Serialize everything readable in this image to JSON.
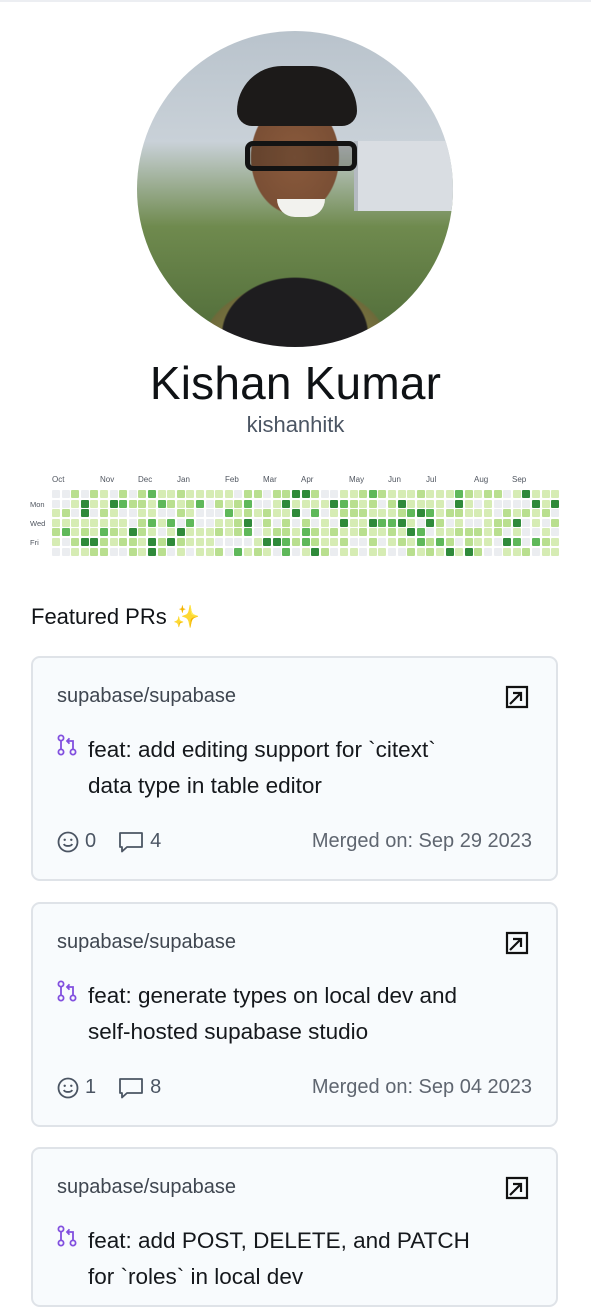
{
  "profile": {
    "name": "Kishan Kumar",
    "handle": "kishanhitk"
  },
  "contributions": {
    "months": [
      "Oct",
      "Nov",
      "Dec",
      "Jan",
      "Feb",
      "Mar",
      "Apr",
      "May",
      "Jun",
      "Jul",
      "Aug",
      "Sep"
    ],
    "days": [
      "Mon",
      "Wed",
      "Fri"
    ],
    "colors": {
      "none": "#ebedf0",
      "l1": "#d6ecb4",
      "l2": "#b9df8f",
      "l3": "#5fb85a",
      "l4": "#2f8a3a"
    }
  },
  "featured": {
    "title": "Featured PRs",
    "emoji": "✨",
    "prs": [
      {
        "repo": "supabase/supabase",
        "title_line1": "feat: add editing support for `citext`",
        "title_line2": "data type in table editor",
        "reactions": "0",
        "comments": "4",
        "merged": "Merged on: Sep 29 2023"
      },
      {
        "repo": "supabase/supabase",
        "title_line1": "feat: generate types on local dev and",
        "title_line2": "self-hosted supabase studio",
        "reactions": "1",
        "comments": "8",
        "merged": "Merged on: Sep 04 2023"
      },
      {
        "repo": "supabase/supabase",
        "title_line1": "feat: add POST, DELETE, and PATCH",
        "title_line2": "for `roles` in local dev",
        "reactions": "",
        "comments": "",
        "merged": ""
      }
    ]
  }
}
